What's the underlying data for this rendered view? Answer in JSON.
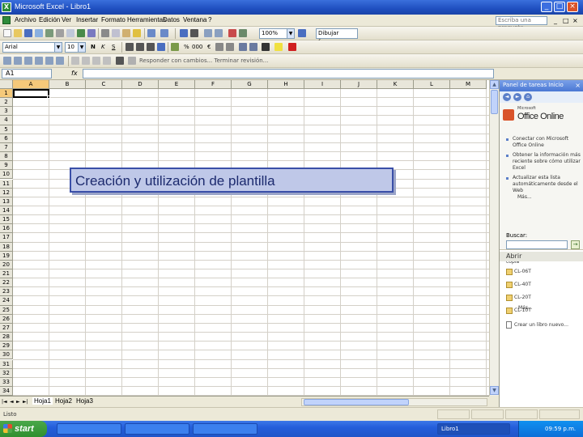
{
  "window": {
    "title": "Microsoft Excel - Libro1",
    "app_icon": "X",
    "minimize_icon": "_",
    "maximize_icon": "□",
    "close_icon": "×"
  },
  "menu": {
    "items": [
      "Archivo",
      "Edición",
      "Ver",
      "Insertar",
      "Formato",
      "Herramientas",
      "Datos",
      "Ventana",
      "?"
    ],
    "help_placeholder": "Escriba una pregunta",
    "doc_controls": [
      "_",
      "□",
      "×"
    ]
  },
  "toolbar1": {
    "zoom": "100%",
    "view_combo": "Dibujar forma"
  },
  "toolbar2": {
    "font_name": "Arial",
    "font_size": "10",
    "bold": "N",
    "italic": "K",
    "underline": "S",
    "percent": "%",
    "thousands": "000",
    "euro": "€"
  },
  "toolbar3": {
    "review_text": "Responder con cambios...  Terminar revisión..."
  },
  "formula_bar": {
    "name_box": "A1",
    "fx_label": "fx",
    "formula": ""
  },
  "grid": {
    "columns": [
      "A",
      "B",
      "C",
      "D",
      "E",
      "F",
      "G",
      "H",
      "I",
      "J",
      "K",
      "L",
      "M"
    ],
    "rows": [
      "1",
      "2",
      "3",
      "4",
      "5",
      "6",
      "7",
      "8",
      "9",
      "10",
      "11",
      "12",
      "13",
      "14",
      "15",
      "16",
      "17",
      "18",
      "19",
      "20",
      "21",
      "22",
      "23",
      "24",
      "25",
      "26",
      "27",
      "28",
      "29",
      "30",
      "31",
      "32",
      "33",
      "34"
    ],
    "active_cell": "A1"
  },
  "overlay": {
    "title": "Creación y utilización de plantilla"
  },
  "sheets": {
    "nav": [
      "|◄",
      "◄",
      "►",
      "►|"
    ],
    "tabs": [
      "Hoja1",
      "Hoja2",
      "Hoja3"
    ],
    "active": "Hoja1"
  },
  "status": {
    "text": "Listo"
  },
  "task_pane": {
    "title": "Panel de tareas Inicio",
    "close": "×",
    "nav": [
      "◄",
      "►",
      "⌂"
    ],
    "brand_small": "Microsoft",
    "brand": "Office Online",
    "links": [
      "Conectar con Microsoft Office Online",
      "Obtener la información más reciente sobre cómo utilizar Excel",
      "Actualizar esta lista automáticamente desde el Web"
    ],
    "more": "Más...",
    "search_label": "Buscar:",
    "search_go": "→",
    "example": "Ejemplo: \"Imprimir más de una copia\"",
    "open_section": "Abrir",
    "recent_files": [
      "CL-06T",
      "CL-40T",
      "CL-20T",
      "CL-10T"
    ],
    "more_files": "Más...",
    "new_workbook": "Crear un libro nuevo..."
  },
  "taskbar": {
    "start": "start",
    "tasks": [
      "",
      "",
      "",
      "Libro1"
    ],
    "clock": "09:59 p.m."
  }
}
